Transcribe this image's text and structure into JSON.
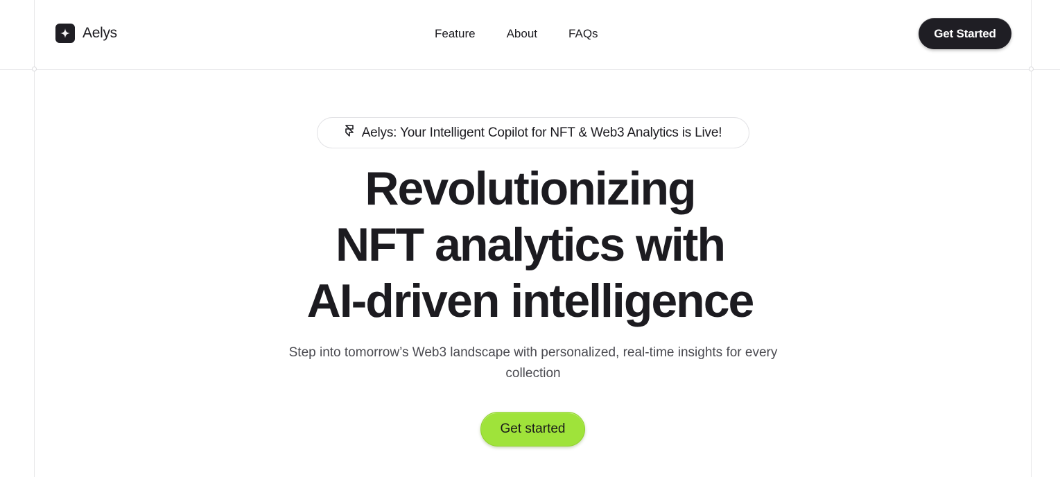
{
  "brand": {
    "name": "Aelys",
    "logo_icon": "sparkle-icon"
  },
  "nav": {
    "items": [
      {
        "label": "Feature"
      },
      {
        "label": "About"
      },
      {
        "label": "FAQs"
      }
    ]
  },
  "header": {
    "cta_label": "Get Started"
  },
  "hero": {
    "announcement": {
      "icon": "framer-icon",
      "text": "Aelys: Your Intelligent Copilot for NFT & Web3 Analytics is Live!"
    },
    "headline_lines": [
      "Revolutionizing",
      "NFT analytics with",
      "AI-driven intelligence"
    ],
    "subtitle": "Step into tomorrow’s Web3 landscape with personalized, real-time insights for every collection",
    "cta_label": "Get started"
  },
  "colors": {
    "primary_dark": "#1f1e24",
    "accent_green": "#9fe33a",
    "text": "#1c1b20",
    "muted_text": "#4a4a50",
    "border": "#e6e6e8"
  }
}
